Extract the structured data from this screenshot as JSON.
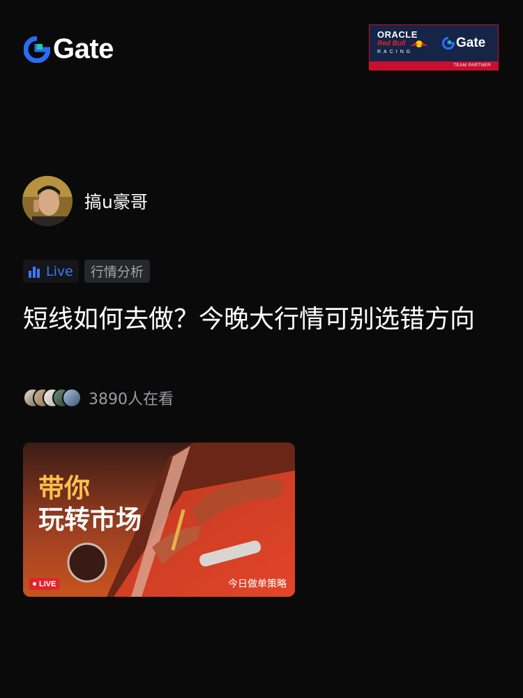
{
  "brand": {
    "name": "Gate",
    "logo_icon": "gate-logo-icon"
  },
  "partner": {
    "line1": "ORACLE",
    "line2": "Red Bull",
    "line3": "RACING",
    "brand": "Gate",
    "caption": "TEAM PARTNER",
    "bg_color": "#152447",
    "accent_color": "#c8102e"
  },
  "host": {
    "name": "搞u豪哥",
    "avatar": "host-avatar"
  },
  "tags": {
    "live_label": "Live",
    "live_icon": "bar-chart-icon",
    "category": "行情分析"
  },
  "stream": {
    "title": "短线如何去做？今晚大行情可别选错方向",
    "viewers": "3890人在看",
    "viewer_avatars": [
      "viewer-avatar-1",
      "viewer-avatar-2",
      "viewer-avatar-3",
      "viewer-avatar-4",
      "viewer-avatar-5"
    ]
  },
  "card": {
    "headline1": "带你",
    "headline2": "玩转市场",
    "badge": "LIVE",
    "subtitle": "今日做单策略"
  },
  "colors": {
    "background": "#0a0a0b",
    "accent_blue": "#3a7cf5",
    "live_red": "#e0242a",
    "headline_yellow": "#ffc04d"
  }
}
